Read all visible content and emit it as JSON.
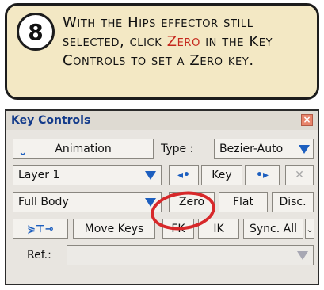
{
  "callout": {
    "step_number": "8",
    "text_1": "With the Hips effector still selected, click ",
    "highlight": "Zero",
    "text_2": " in the Key Controls to set a Zero key."
  },
  "panel": {
    "title": "Key Controls",
    "close_glyph": "×",
    "row1": {
      "mode_button": "Animation",
      "type_label": "Type :",
      "type_value": "Bezier-Auto"
    },
    "row2": {
      "layer_value": "Layer 1",
      "prev_glyph": "◂•",
      "key_button": "Key",
      "next_glyph": "•▸",
      "delete_glyph": "✕"
    },
    "row3": {
      "body_value": "Full Body",
      "zero_button": "Zero",
      "flat_button": "Flat",
      "disc_button": "Disc."
    },
    "row4": {
      "key_tool_glyph": "⋟⊤⊸",
      "move_keys_button": "Move Keys",
      "fk_button": "FK",
      "ik_button": "IK",
      "sync_button": "Sync. All",
      "sync_arrow": "⌄"
    },
    "row5": {
      "ref_label": "Ref.:",
      "ref_value": ""
    }
  },
  "colors": {
    "accent_blue": "#1d5fbf",
    "highlight_red": "#c5281d",
    "callout_bg": "#f3e8c4"
  }
}
